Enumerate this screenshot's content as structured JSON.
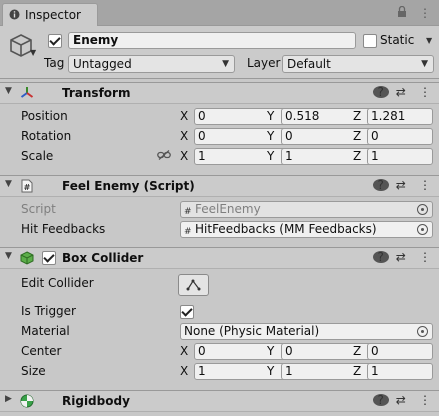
{
  "tab": {
    "label": "Inspector",
    "lock_icon": "lock-icon",
    "menu_icon": "kebab-menu-icon"
  },
  "gameobject": {
    "active": true,
    "name": "Enemy",
    "static_label": "Static",
    "static_checked": false,
    "tag_label": "Tag",
    "tag_value": "Untagged",
    "layer_label": "Layer",
    "layer_value": "Default"
  },
  "transform": {
    "title": "Transform",
    "position_label": "Position",
    "rotation_label": "Rotation",
    "scale_label": "Scale",
    "axis_x": "X",
    "axis_y": "Y",
    "axis_z": "Z",
    "position": {
      "x": "0",
      "y": "0.518",
      "z": "1.281"
    },
    "rotation": {
      "x": "0",
      "y": "0",
      "z": "0"
    },
    "scale": {
      "x": "1",
      "y": "1",
      "z": "1"
    }
  },
  "feel_enemy": {
    "title": "Feel Enemy (Script)",
    "script_label": "Script",
    "script_value": "FeelEnemy",
    "hit_feedbacks_label": "Hit Feedbacks",
    "hit_feedbacks_value": "HitFeedbacks (MM Feedbacks)"
  },
  "box_collider": {
    "title": "Box Collider",
    "enabled": true,
    "edit_collider_label": "Edit Collider",
    "is_trigger_label": "Is Trigger",
    "is_trigger": true,
    "material_label": "Material",
    "material_value": "None (Physic Material)",
    "center_label": "Center",
    "size_label": "Size",
    "axis_x": "X",
    "axis_y": "Y",
    "axis_z": "Z",
    "center": {
      "x": "0",
      "y": "0",
      "z": "0"
    },
    "size": {
      "x": "1",
      "y": "1",
      "z": "1"
    }
  },
  "rigidbody": {
    "title": "Rigidbody"
  },
  "colors": {
    "panel": "#c8c8c8",
    "header": "#cbcbcb",
    "field": "#f0f0f0",
    "tabbar": "#a5a5a5"
  }
}
